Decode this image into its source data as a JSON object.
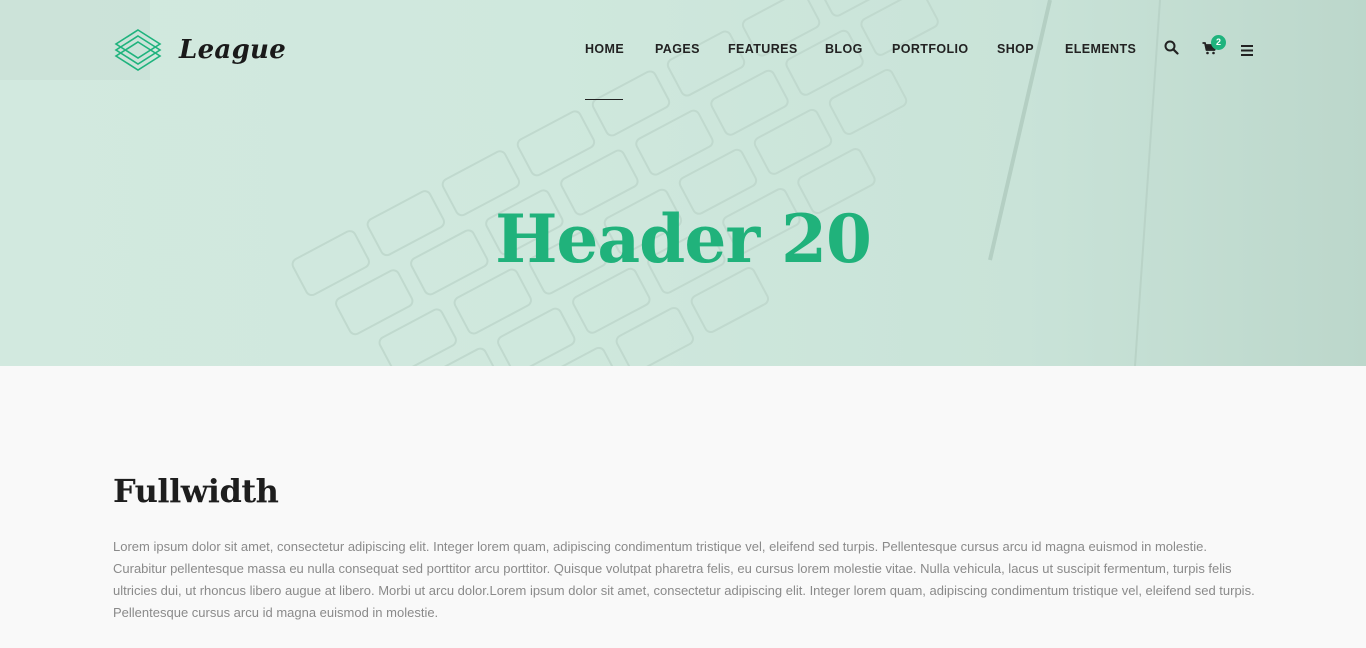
{
  "brand": {
    "name": "League",
    "accent": "#1fb37d"
  },
  "nav": {
    "items": [
      {
        "label": "HOME"
      },
      {
        "label": "PAGES"
      },
      {
        "label": "FEATURES"
      },
      {
        "label": "BLOG"
      },
      {
        "label": "PORTFOLIO"
      },
      {
        "label": "SHOP"
      },
      {
        "label": "ELEMENTS"
      }
    ],
    "active": "HOME",
    "icons": [
      "search-icon",
      "cart-icon",
      "menu-icon"
    ],
    "cart_count": "2"
  },
  "hero": {
    "title": "Header 20"
  },
  "section": {
    "title": "Fullwidth",
    "body": "Lorem ipsum dolor sit amet, consectetur adipiscing elit. Integer lorem quam, adipiscing condimentum tristique vel, eleifend sed turpis. Pellentesque cursus arcu id magna euismod in molestie. Curabitur pellentesque massa eu nulla consequat sed porttitor arcu porttitor. Quisque volutpat pharetra felis, eu cursus lorem molestie vitae. Nulla vehicula, lacus ut suscipit fermentum, turpis felis ultricies dui, ut rhoncus libero augue at libero. Morbi ut arcu dolor.Lorem ipsum dolor sit amet, consectetur adipiscing elit. Integer lorem quam, adipiscing condimentum tristique vel, eleifend sed turpis. Pellentesque cursus arcu id magna euismod in molestie."
  }
}
